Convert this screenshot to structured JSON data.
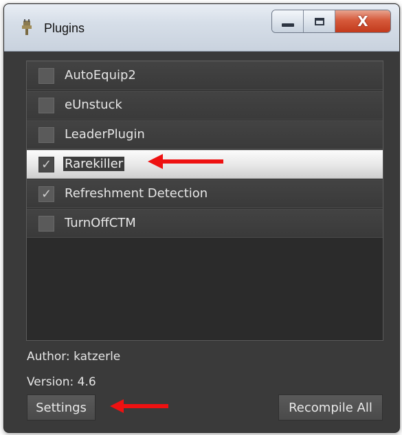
{
  "window": {
    "title": "Plugins",
    "icon": "plugin-plug-icon",
    "controls": {
      "minimize": "minimize-icon",
      "maximize": "maximize-icon",
      "close": "close-icon",
      "close_glyph": "X"
    }
  },
  "plugins": {
    "items": [
      {
        "label": "AutoEquip2",
        "checked": false
      },
      {
        "label": "eUnstuck",
        "checked": false
      },
      {
        "label": "LeaderPlugin",
        "checked": false
      },
      {
        "label": "Rarekiller",
        "checked": true,
        "selected": true
      },
      {
        "label": "Refreshment Detection",
        "checked": true
      },
      {
        "label": "TurnOffCTM",
        "checked": false
      }
    ],
    "check_glyph": "✓"
  },
  "details": {
    "author": "Author:  katzerle",
    "version": "Version: 4.6"
  },
  "buttons": {
    "settings": "Settings",
    "recompile_all": "Recompile All"
  },
  "annotations": {
    "arrow_color": "#ee1111"
  },
  "colors": {
    "panel": "#3a3a3a",
    "list_bg": "#2b2b2b",
    "text": "#e6e6e6"
  }
}
